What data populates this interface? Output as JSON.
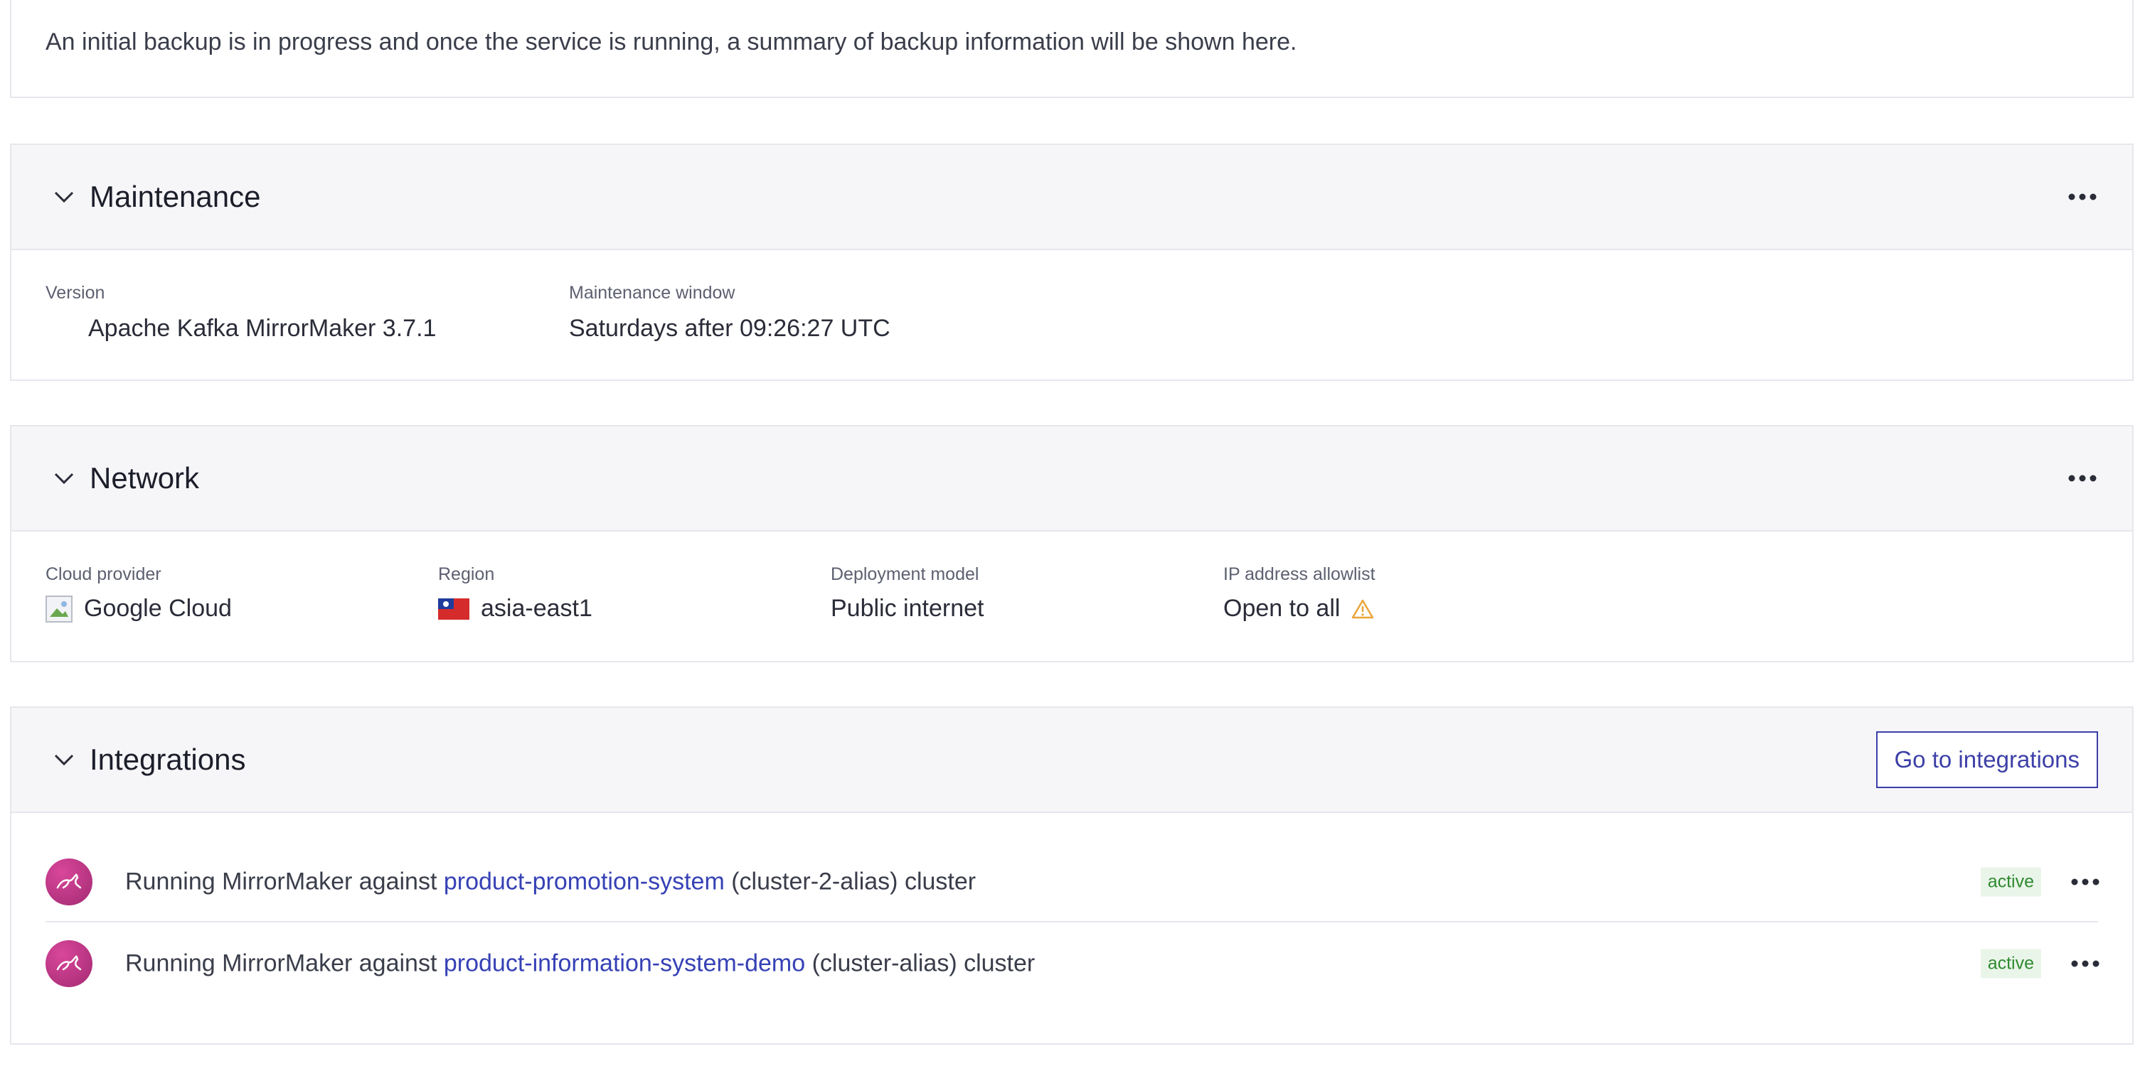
{
  "backup": {
    "message": "An initial backup is in progress and once the service is running, a summary of backup information will be shown here."
  },
  "maintenance": {
    "title": "Maintenance",
    "version_label": "Version",
    "version_value": "Apache Kafka MirrorMaker 3.7.1",
    "window_label": "Maintenance window",
    "window_value": "Saturdays after 09:26:27 UTC"
  },
  "network": {
    "title": "Network",
    "cloud_label": "Cloud provider",
    "cloud_value": "Google Cloud",
    "region_label": "Region",
    "region_value": "asia-east1",
    "deployment_label": "Deployment model",
    "deployment_value": "Public internet",
    "ip_label": "IP address allowlist",
    "ip_value": "Open to all",
    "warning_color": "#e8a53a"
  },
  "integrations": {
    "title": "Integrations",
    "goto_label": "Go to integrations",
    "items": [
      {
        "prefix": "Running MirrorMaker against",
        "link": "product-promotion-system",
        "suffix": "(cluster-2-alias) cluster",
        "status": "active"
      },
      {
        "prefix": "Running MirrorMaker against",
        "link": "product-information-system-demo",
        "suffix": "(cluster-alias) cluster",
        "status": "active"
      }
    ]
  },
  "colors": {
    "accent": "#3d40a7",
    "header_bg": "#f6f6f8",
    "border": "#e6e7ec",
    "badge_bg": "#eaf5ea",
    "badge_text": "#2f8a2f"
  }
}
